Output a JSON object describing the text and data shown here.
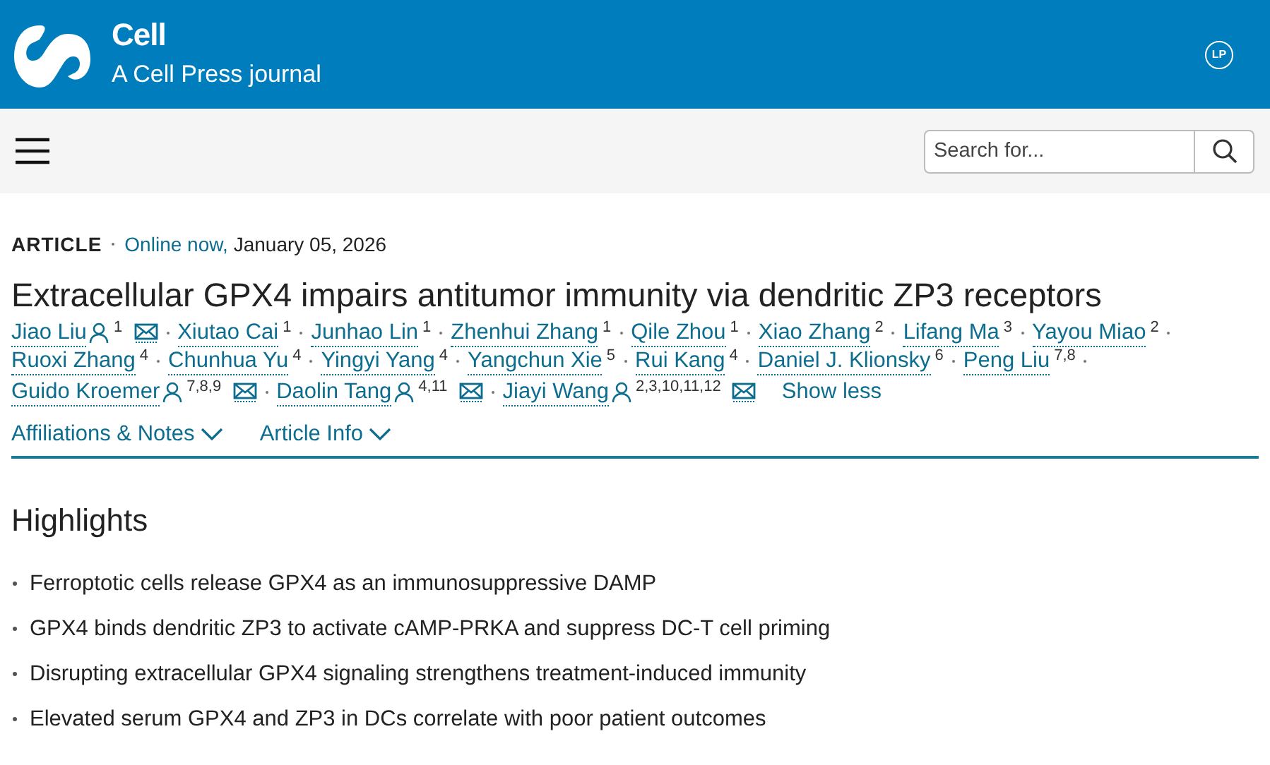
{
  "header": {
    "journal": "Cell",
    "subtitle": "A Cell Press journal",
    "user_initials": "LP"
  },
  "search": {
    "placeholder": "Search for..."
  },
  "article": {
    "type": "ARTICLE",
    "status": "Online now,",
    "date": "January 05, 2026",
    "title": "Extracellular GPX4 impairs antitumor immunity via dendritic ZP3 receptors",
    "authors": [
      {
        "name": "Jiao Liu",
        "affiliations": "1",
        "orcid": true,
        "email": true
      },
      {
        "name": "Xiutao Cai",
        "affiliations": "1",
        "orcid": false,
        "email": false
      },
      {
        "name": "Junhao Lin",
        "affiliations": "1",
        "orcid": false,
        "email": false
      },
      {
        "name": "Zhenhui Zhang",
        "affiliations": "1",
        "orcid": false,
        "email": false
      },
      {
        "name": "Qile Zhou",
        "affiliations": "1",
        "orcid": false,
        "email": false
      },
      {
        "name": "Xiao Zhang",
        "affiliations": "2",
        "orcid": false,
        "email": false
      },
      {
        "name": "Lifang Ma",
        "affiliations": "3",
        "orcid": false,
        "email": false
      },
      {
        "name": "Yayou Miao",
        "affiliations": "2",
        "orcid": false,
        "email": false
      },
      {
        "name": "Ruoxi Zhang",
        "affiliations": "4",
        "orcid": false,
        "email": false
      },
      {
        "name": "Chunhua Yu",
        "affiliations": "4",
        "orcid": false,
        "email": false
      },
      {
        "name": "Yingyi Yang",
        "affiliations": "4",
        "orcid": false,
        "email": false
      },
      {
        "name": "Yangchun Xie",
        "affiliations": "5",
        "orcid": false,
        "email": false
      },
      {
        "name": "Rui Kang",
        "affiliations": "4",
        "orcid": false,
        "email": false
      },
      {
        "name": "Daniel J. Klionsky",
        "affiliations": "6",
        "orcid": false,
        "email": false
      },
      {
        "name": "Peng Liu",
        "affiliations": "7,8",
        "orcid": false,
        "email": false
      },
      {
        "name": "Guido Kroemer",
        "affiliations": "7,8,9",
        "orcid": true,
        "email": true
      },
      {
        "name": "Daolin Tang",
        "affiliations": "4,11",
        "orcid": true,
        "email": true
      },
      {
        "name": "Jiayi Wang",
        "affiliations": "2,3,10,11,12",
        "orcid": true,
        "email": true
      }
    ],
    "show_less": "Show less",
    "sections": [
      {
        "label": "Affiliations & Notes",
        "expanded": false
      },
      {
        "label": "Article Info",
        "expanded": false
      }
    ]
  },
  "highlights": {
    "heading": "Highlights",
    "items": [
      "Ferroptotic cells release GPX4 as an immunosuppressive DAMP",
      "GPX4 binds dendritic ZP3 to activate cAMP-PRKA and suppress DC-T cell priming",
      "Disrupting extracellular GPX4 signaling strengthens treatment-induced immunity",
      "Elevated serum GPX4 and ZP3 in DCs correlate with poor patient outcomes"
    ]
  }
}
